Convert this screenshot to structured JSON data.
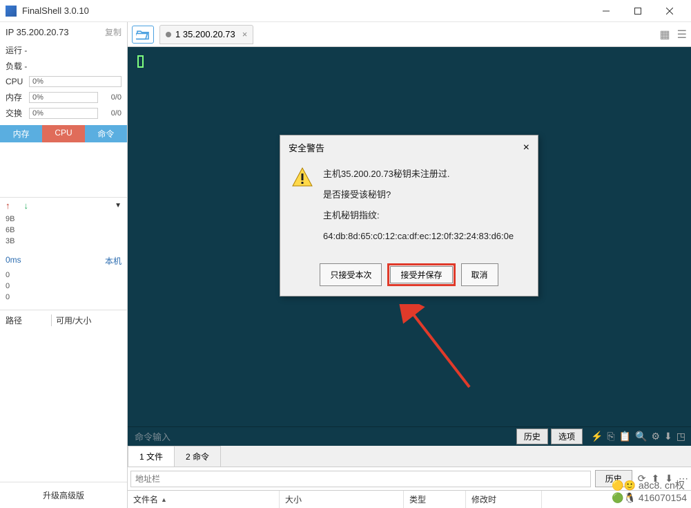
{
  "window": {
    "title": "FinalShell 3.0.10"
  },
  "sidebar": {
    "ip": "IP 35.200.20.73",
    "copy": "复制",
    "run": "运行 -",
    "load": "负载 -",
    "cpu_label": "CPU",
    "cpu_val": "0%",
    "mem_label": "内存",
    "mem_val": "0%",
    "mem_ratio": "0/0",
    "swap_label": "交换",
    "swap_val": "0%",
    "swap_ratio": "0/0",
    "tabs": {
      "mem": "内存",
      "cpu": "CPU",
      "cmd": "命令"
    },
    "bytes": [
      "9B",
      "6B",
      "3B"
    ],
    "ping": "0ms",
    "host": "本机",
    "zeros": [
      "0",
      "0",
      "0"
    ],
    "path_label": "路径",
    "size_label": "可用/大小",
    "upgrade": "升级高级版"
  },
  "tabbar": {
    "conn_label": "1 35.200.20.73"
  },
  "terminal": {
    "cmd_placeholder": "命令输入",
    "history_btn": "历史",
    "options_btn": "选项"
  },
  "bottom": {
    "tab1": "1 文件",
    "tab2": "2 命令",
    "addr_placeholder": "地址栏",
    "history_btn": "历史",
    "cols": {
      "name": "文件名",
      "size": "大小",
      "type": "类型",
      "mtime": "修改时"
    }
  },
  "dialog": {
    "title": "安全警告",
    "line1": "主机35.200.20.73秘钥未注册过.",
    "line2": "是否接受该秘钥?",
    "line3": "主机秘钥指纹:",
    "fingerprint": "64:db:8d:65:c0:12:ca:df:ec:12:0f:32:24:83:d6:0e",
    "btn_once": "只接受本次",
    "btn_accept": "接受并保存",
    "btn_cancel": "取消"
  },
  "watermark": {
    "l1": "a8c8. cn权",
    "l2": "416070154"
  }
}
